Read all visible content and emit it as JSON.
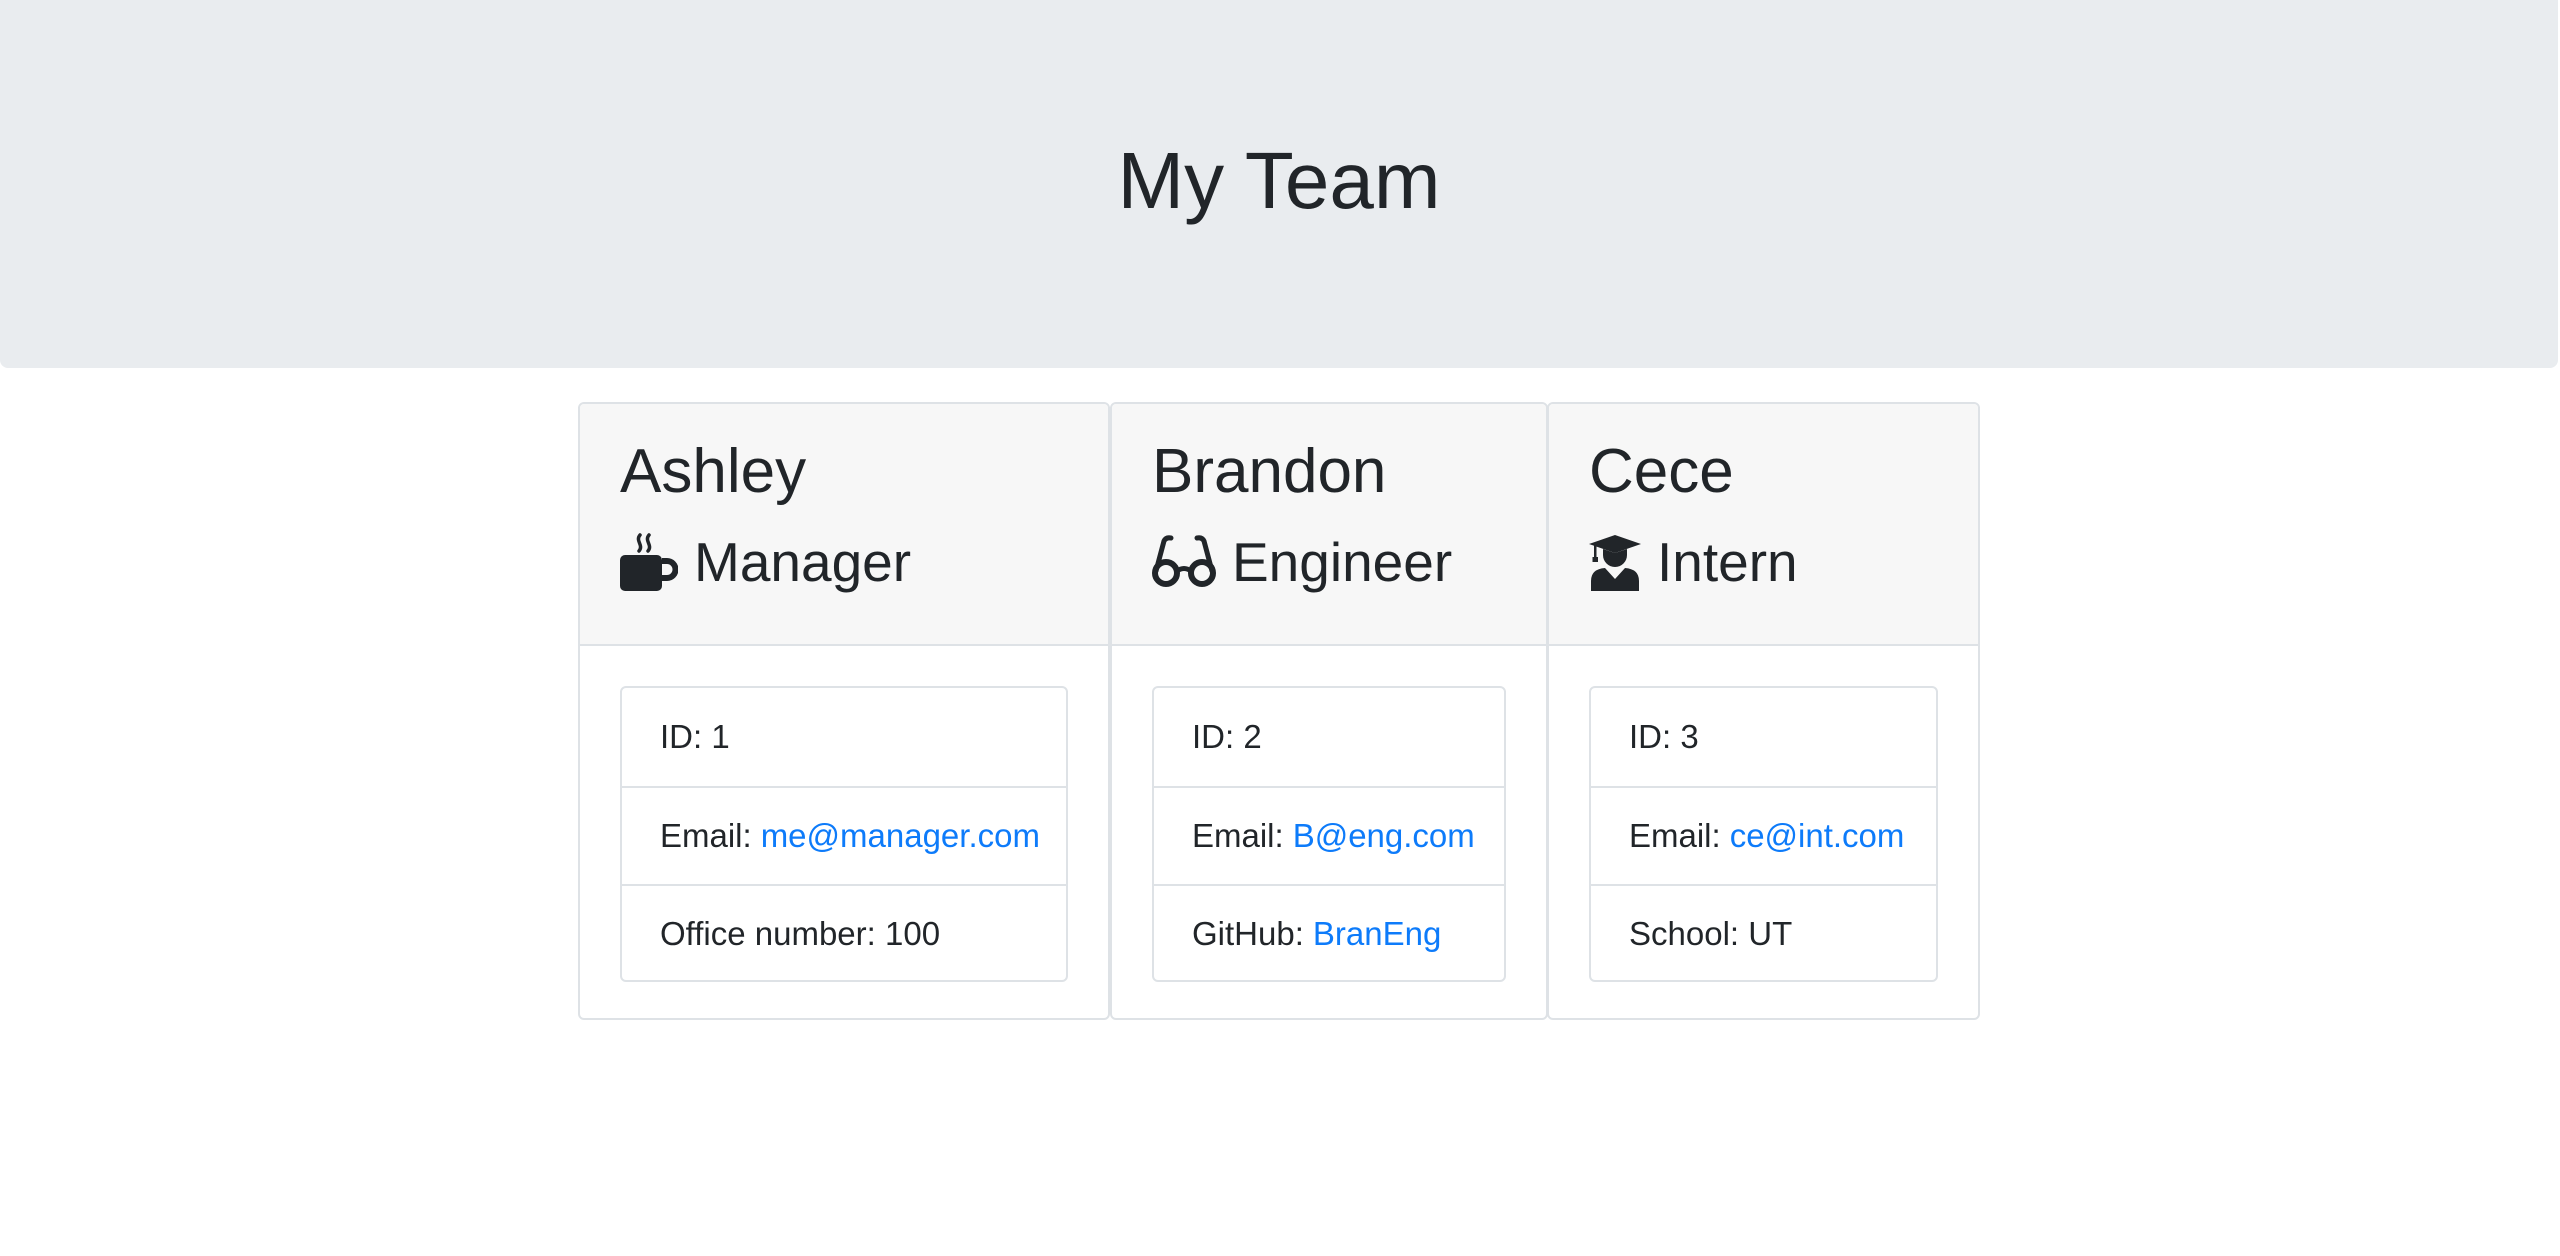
{
  "header": {
    "title": "My Team"
  },
  "team": [
    {
      "name": "Ashley",
      "role": "Manager",
      "role_icon": "coffee-mug-icon",
      "id_label": "ID:",
      "id_value": "1",
      "email_label": "Email:",
      "email": "me@manager.com",
      "extra_label": "Office number:",
      "extra_value": "100"
    },
    {
      "name": "Brandon",
      "role": "Engineer",
      "role_icon": "glasses-icon",
      "id_label": "ID:",
      "id_value": "2",
      "email_label": "Email:",
      "email": "B@eng.com",
      "extra_label": "GitHub:",
      "extra_value": "BranEng"
    },
    {
      "name": "Cece",
      "role": "Intern",
      "role_icon": "graduate-icon",
      "id_label": "ID:",
      "id_value": "3",
      "email_label": "Email:",
      "email": "ce@int.com",
      "extra_label": "School:",
      "extra_value": "UT"
    }
  ],
  "colors": {
    "header_background": "#e9ecef",
    "card_header_background": "#f7f7f7",
    "link": "#0d7bfa",
    "text": "#212529",
    "border": "#dee2e6"
  }
}
